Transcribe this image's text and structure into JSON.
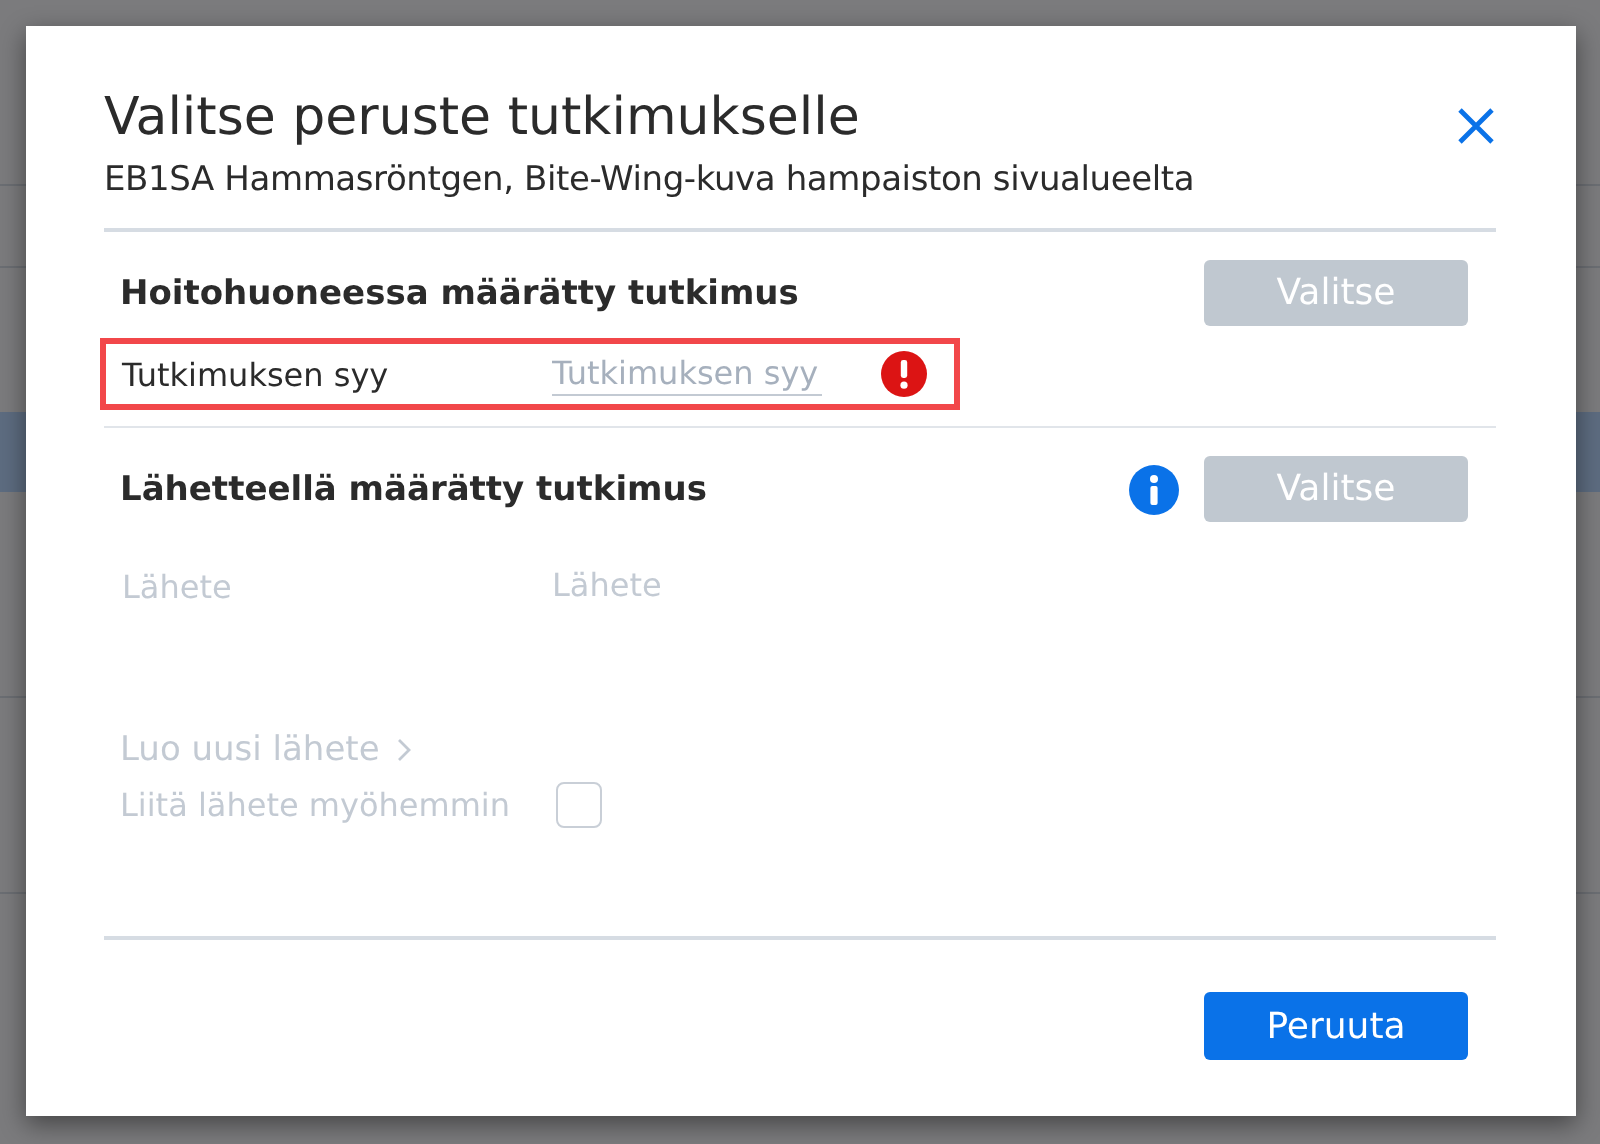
{
  "dialog": {
    "title": "Valitse peruste tutkimukselle",
    "subtitle": "EB1SA Hammasröntgen, Bite-Wing-kuva hampaiston sivualueelta",
    "sections": [
      {
        "heading": "Hoitohuoneessa määrätty tutkimus",
        "info": false,
        "button": {
          "label": "Valitse",
          "disabled": true
        },
        "fields": [
          {
            "label": "Tutkimuksen syy",
            "placeholder": "Tutkimuksen syy",
            "disabled": false,
            "error": true,
            "highlighted": true
          }
        ]
      },
      {
        "heading": "Lähetteellä määrätty tutkimus",
        "info": true,
        "button": {
          "label": "Valitse",
          "disabled": true
        },
        "fields": [
          {
            "label": "Lähete",
            "placeholder": "Lähete",
            "disabled": true,
            "error": false,
            "highlighted": false
          }
        ]
      }
    ],
    "link": {
      "label": "Luo uusi lähete",
      "disabled": true
    },
    "checkbox": {
      "label": "Liitä lähete myöhemmin",
      "checked": false,
      "disabled": true
    },
    "footer_button": {
      "label": "Peruuta",
      "disabled": false
    }
  }
}
